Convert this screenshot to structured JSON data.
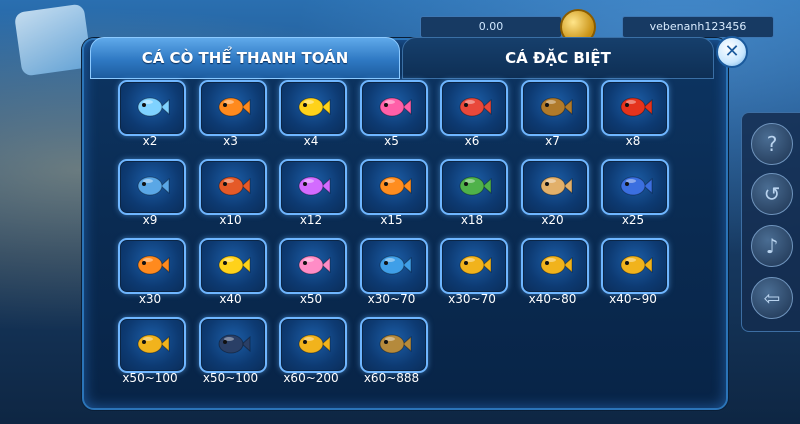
{
  "background": {
    "top_value": "0.00",
    "username": "vebenanh123456"
  },
  "tabs": [
    {
      "label": "CÁ CÒ THỂ THANH TOÁN",
      "active": true
    },
    {
      "label": "CÁ ĐẶC BIỆT",
      "active": false
    }
  ],
  "close_label": "✕",
  "side_buttons": [
    {
      "name": "help-icon",
      "glyph": "?"
    },
    {
      "name": "history-icon",
      "glyph": "↺"
    },
    {
      "name": "sound-icon",
      "glyph": "♪"
    },
    {
      "name": "exit-icon",
      "glyph": "⇦"
    }
  ],
  "fish": [
    {
      "name": "flying-fish",
      "multiplier": "x2",
      "color": "#7fd2ff"
    },
    {
      "name": "clownfish",
      "multiplier": "x3",
      "color": "#ff8a1e"
    },
    {
      "name": "angelfish",
      "multiplier": "x4",
      "color": "#ffd21a"
    },
    {
      "name": "pufferfish-pink",
      "multiplier": "x5",
      "color": "#ff5fa8"
    },
    {
      "name": "lionfish",
      "multiplier": "x6",
      "color": "#e9483a"
    },
    {
      "name": "flounder",
      "multiplier": "x7",
      "color": "#b07a2a"
    },
    {
      "name": "lobster",
      "multiplier": "x8",
      "color": "#e5331c"
    },
    {
      "name": "swordfish",
      "multiplier": "x9",
      "color": "#5aa7e6"
    },
    {
      "name": "octopus",
      "multiplier": "x10",
      "color": "#e55a28"
    },
    {
      "name": "jellyfish",
      "multiplier": "x12",
      "color": "#d36bff"
    },
    {
      "name": "anglerfish",
      "multiplier": "x15",
      "color": "#ff8d1f"
    },
    {
      "name": "turtle",
      "multiplier": "x18",
      "color": "#4fb24a"
    },
    {
      "name": "sawfish",
      "multiplier": "x20",
      "color": "#e2b06a"
    },
    {
      "name": "manta-ray",
      "multiplier": "x25",
      "color": "#3b6fe0"
    },
    {
      "name": "big-clownfish",
      "multiplier": "x30",
      "color": "#ff8a1e"
    },
    {
      "name": "big-angelfish",
      "multiplier": "x40",
      "color": "#ffd21a"
    },
    {
      "name": "big-pufferfish",
      "multiplier": "x50",
      "color": "#ff8cc6"
    },
    {
      "name": "shark",
      "multiplier": "x30~70",
      "color": "#3f9fe8"
    },
    {
      "name": "golden-goldfish",
      "multiplier": "x30~70",
      "color": "#f1b31c"
    },
    {
      "name": "golden-angelfish",
      "multiplier": "x40~80",
      "color": "#f1b31c"
    },
    {
      "name": "golden-pufferfish",
      "multiplier": "x40~90",
      "color": "#f1b31c"
    },
    {
      "name": "golden-shark",
      "multiplier": "x50~100",
      "color": "#f1b31c"
    },
    {
      "name": "killer-whale",
      "multiplier": "x50~100",
      "color": "#2a3f66"
    },
    {
      "name": "golden-carp",
      "multiplier": "x60~200",
      "color": "#f1b31c"
    },
    {
      "name": "golden-dragon",
      "multiplier": "x60~888",
      "color": "#b58a3c"
    }
  ]
}
